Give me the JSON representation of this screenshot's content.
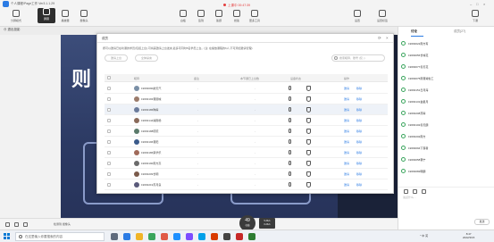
{
  "app": {
    "title": "个人课程/Page工作 Ver3.1.1.29",
    "timer": "上课中 00:47:39"
  },
  "toolbar": {
    "left": [
      {
        "label": "分屏模式",
        "icon": "split-screen-icon"
      },
      {
        "label": "屏幕",
        "icon": "screen-icon"
      },
      {
        "label": "播放器",
        "icon": "player-icon"
      },
      {
        "label": "摄像头",
        "icon": "camera-icon"
      }
    ],
    "center": [
      {
        "label": "白板",
        "icon": "whiteboard-icon"
      },
      {
        "label": "签到",
        "icon": "signin-icon"
      },
      {
        "label": "答题",
        "icon": "quiz-icon"
      },
      {
        "label": "抢答",
        "icon": "rush-answer-icon"
      },
      {
        "label": "更多工具",
        "icon": "more-tools-icon"
      }
    ],
    "right": [
      {
        "label": "设置",
        "icon": "settings-icon"
      },
      {
        "label": "设置标签",
        "icon": "tag-icon"
      },
      {
        "label": "下课",
        "icon": "end-class-icon"
      }
    ]
  },
  "subbar": {
    "exit_label": "退出投影"
  },
  "slide": {
    "big_text": "则"
  },
  "dialog": {
    "title": "成员",
    "description": "按可以邀请已在听课的学员(包括上台),可将其邀请上台发言,最多可同时8名学员上台。(注: 在播放课程的6人,不可添加邀请管理)",
    "btn_invite": "邀请上台",
    "btn_mute_all": "全体禁言",
    "search_placeholder": "搜索昵称、账号 (仅..)",
    "columns": [
      "昵称",
      "备注",
      "本节课已上台数",
      "设备状态",
      "操作"
    ],
    "rows": [
      {
        "account": "19693090航天汽",
        "avatar": "#7a8fa6",
        "highlight": false
      },
      {
        "account": "19693193晋圆城",
        "avatar": "#9b7b6b",
        "highlight": false
      },
      {
        "account": "19693186陶晴",
        "avatar": "#6b7b9b",
        "highlight": true
      },
      {
        "account": "19693144湖南杨",
        "avatar": "#8a6a5a",
        "highlight": false
      },
      {
        "account": "19693188晓晓",
        "avatar": "#5a7a6a",
        "highlight": false
      },
      {
        "account": "19693196晋阳",
        "avatar": "#3a5a8a",
        "highlight": false
      },
      {
        "account": "19693186荣华乐",
        "avatar": "#a06a5a",
        "highlight": false
      },
      {
        "account": "19693190南方高",
        "avatar": "#6a6a6a",
        "highlight": false
      },
      {
        "account": "19693209长明",
        "avatar": "#7a5a4a",
        "highlight": false
      },
      {
        "account": "19693219苏月良",
        "avatar": "#5a5a7a",
        "highlight": false
      }
    ],
    "action_invite": "邀请",
    "action_remove": "移除"
  },
  "stage_bottom": {
    "status": "检测到 摄像头",
    "live_num": "49",
    "live_unit": "在线",
    "speed_up": "5.3K/s",
    "speed_down": "0.2K/s"
  },
  "rpanel": {
    "tab_chat": "讨论",
    "tab_members": "成员(27)",
    "items": [
      "19693022南方有",
      "19693056长城花",
      "19693077冬天花",
      "19693075南晋湖省工",
      "19693151日月海",
      "19693131金星月",
      "19693208苏晴",
      "19693102冬天朗",
      "19693202南方",
      "19693094下落者",
      "19693058晋宁",
      "19693082明朗"
    ],
    "input_placeholder": "说点什么…",
    "send_label": "发送"
  },
  "taskbar": {
    "search_placeholder": "在这里输入你要搜索的内容",
    "tray_text": "^ 中 英",
    "time": "8:47",
    "date": "2022/3/15"
  }
}
